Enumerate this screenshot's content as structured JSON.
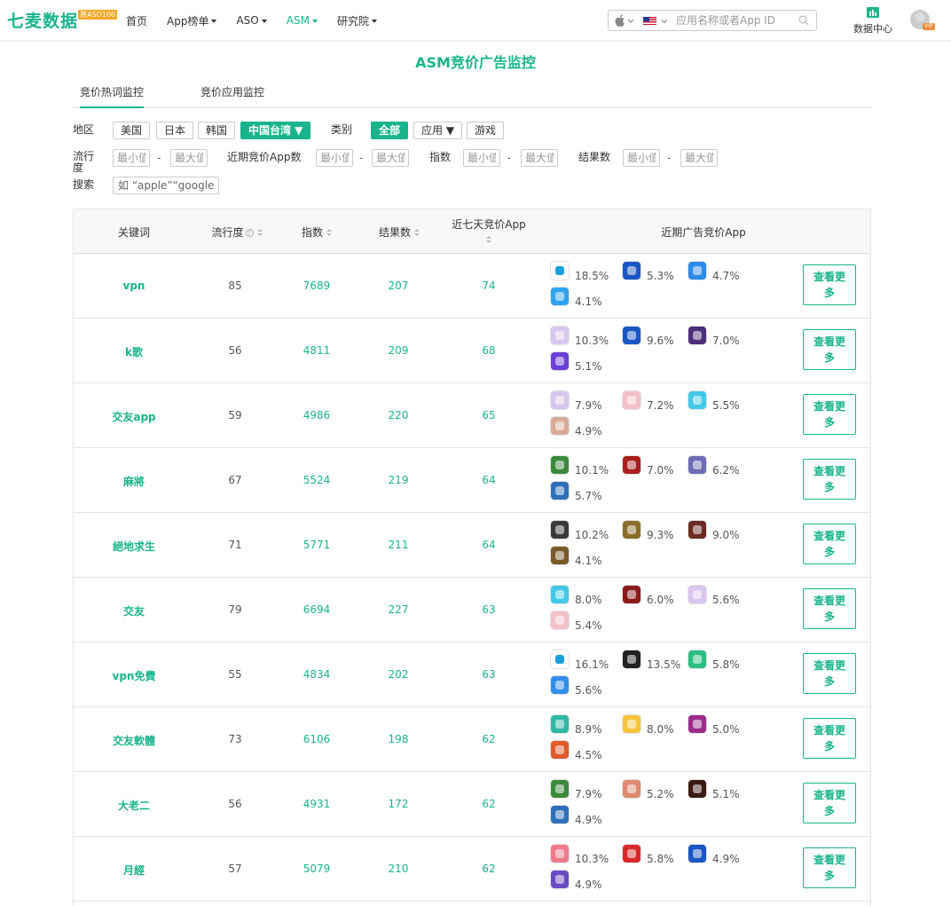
{
  "header": {
    "logo": "七麦数据",
    "logo_badge": "原ASO100",
    "nav": [
      {
        "label": "首页",
        "has_caret": false,
        "active": false
      },
      {
        "label": "App榜单",
        "has_caret": true,
        "active": false
      },
      {
        "label": "ASO",
        "has_caret": true,
        "active": false
      },
      {
        "label": "ASM",
        "has_caret": true,
        "active": true
      },
      {
        "label": "研究院",
        "has_caret": true,
        "active": false
      }
    ],
    "search_placeholder": "应用名称或者App ID",
    "data_center_label": "数据中心",
    "vip_badge": "VIP"
  },
  "page": {
    "title": "ASM竞价广告监控",
    "tabs": [
      "竞价热词监控",
      "竞价应用监控"
    ]
  },
  "filters": {
    "region_label": "地区",
    "regions": [
      {
        "label": "美国",
        "active": false
      },
      {
        "label": "日本",
        "active": false
      },
      {
        "label": "韩国",
        "active": false
      },
      {
        "label": "中国台湾 ▼",
        "active": true
      }
    ],
    "category_label": "类别",
    "categories": [
      {
        "label": "全部",
        "active": true
      },
      {
        "label": "应用 ▼",
        "active": false
      },
      {
        "label": "游戏",
        "active": false
      }
    ],
    "popularity_label": "流行度",
    "recent_apps_label": "近期竞价App数",
    "index_label": "指数",
    "results_label": "结果数",
    "min_placeholder": "最小值",
    "max_placeholder": "最大值",
    "range_dash": "-",
    "search_label": "搜索",
    "search_placeholder": "如 “apple”“google”等"
  },
  "table": {
    "headers": {
      "keyword": "关键词",
      "popularity": "流行度",
      "index": "指数",
      "results": "结果数",
      "seven_days": "近七天竞价App",
      "recent_apps": "近期广告竞价App"
    },
    "help_glyph": "?",
    "more_label": "查看更多",
    "rows": [
      {
        "keyword": "vpn",
        "popularity": "85",
        "index": "7689",
        "results": "207",
        "seven_days": "74",
        "apps": [
          {
            "icon": "wifi-vpn-icon",
            "pct": "18.5%",
            "color": "#ffffff"
          },
          {
            "icon": "m-shield-icon",
            "pct": "5.3%",
            "color": "#1a56c4"
          },
          {
            "icon": "camera-icon",
            "pct": "4.7%",
            "color": "#2d8ae8"
          },
          {
            "icon": "x-vpn-icon",
            "pct": "4.1%",
            "color": "#2fa4f0"
          }
        ]
      },
      {
        "keyword": "k歌",
        "popularity": "56",
        "index": "4811",
        "results": "209",
        "seven_days": "68",
        "apps": [
          {
            "icon": "anime-girl-icon",
            "pct": "10.3%",
            "color": "#d9c6ee"
          },
          {
            "icon": "m-shield-icon",
            "pct": "9.6%",
            "color": "#1a56c4"
          },
          {
            "icon": "music-stage-icon",
            "pct": "7.0%",
            "color": "#4a2e7a"
          },
          {
            "icon": "microphone-icon",
            "pct": "5.1%",
            "color": "#6a3fd8"
          }
        ]
      },
      {
        "keyword": "交友app",
        "popularity": "59",
        "index": "4986",
        "results": "220",
        "seven_days": "65",
        "apps": [
          {
            "icon": "anime-girl-icon",
            "pct": "7.9%",
            "color": "#d9c6ee"
          },
          {
            "icon": "anime-pink-icon",
            "pct": "7.2%",
            "color": "#f3c1c8"
          },
          {
            "icon": "chat-bubble-icon",
            "pct": "5.5%",
            "color": "#43c9e8"
          },
          {
            "icon": "woman-photo-icon",
            "pct": "4.9%",
            "color": "#d9a999"
          }
        ]
      },
      {
        "keyword": "麻將",
        "popularity": "67",
        "index": "5524",
        "results": "219",
        "seven_days": "64",
        "apps": [
          {
            "icon": "mahjong-man-icon",
            "pct": "10.1%",
            "color": "#3b8a3c"
          },
          {
            "icon": "dragon-icon",
            "pct": "7.0%",
            "color": "#a81e1e"
          },
          {
            "icon": "anime-warrior-icon",
            "pct": "6.2%",
            "color": "#6d6cb5"
          },
          {
            "icon": "mahjong-tiles-icon",
            "pct": "5.7%",
            "color": "#2f6fb9"
          }
        ]
      },
      {
        "keyword": "絕地求生",
        "popularity": "71",
        "index": "5771",
        "results": "211",
        "seven_days": "64",
        "apps": [
          {
            "icon": "soldier-icon",
            "pct": "10.2%",
            "color": "#3a3a3a"
          },
          {
            "icon": "battle-icon",
            "pct": "9.3%",
            "color": "#8a6d2a"
          },
          {
            "icon": "shooter-icon",
            "pct": "9.0%",
            "color": "#6b2b22"
          },
          {
            "icon": "survival-icon",
            "pct": "4.1%",
            "color": "#7a5a2a"
          }
        ]
      },
      {
        "keyword": "交友",
        "popularity": "79",
        "index": "6694",
        "results": "227",
        "seven_days": "63",
        "apps": [
          {
            "icon": "chat-bubble-icon",
            "pct": "8.0%",
            "color": "#43c9e8"
          },
          {
            "icon": "ring-icon",
            "pct": "6.0%",
            "color": "#8b1b1b"
          },
          {
            "icon": "anime-girl-icon",
            "pct": "5.6%",
            "color": "#d9c6ee"
          },
          {
            "icon": "anime-pink-icon",
            "pct": "5.4%",
            "color": "#f3c1c8"
          }
        ]
      },
      {
        "keyword": "vpn免費",
        "popularity": "55",
        "index": "4834",
        "results": "202",
        "seven_days": "63",
        "apps": [
          {
            "icon": "wifi-vpn-icon",
            "pct": "16.1%",
            "color": "#ffffff"
          },
          {
            "icon": "g-shield-icon",
            "pct": "13.5%",
            "color": "#222222"
          },
          {
            "icon": "green-arrow-icon",
            "pct": "5.8%",
            "color": "#2bbf82"
          },
          {
            "icon": "v-vpn-icon",
            "pct": "5.6%",
            "color": "#2f8fe8"
          }
        ]
      },
      {
        "keyword": "交友軟體",
        "popularity": "73",
        "index": "6106",
        "results": "198",
        "seven_days": "62",
        "apps": [
          {
            "icon": "house-heart-icon",
            "pct": "8.9%",
            "color": "#30b8a4"
          },
          {
            "icon": "dog-icon",
            "pct": "8.0%",
            "color": "#f7c43c"
          },
          {
            "icon": "hashtag-icon",
            "pct": "5.0%",
            "color": "#9b2d8a"
          },
          {
            "icon": "fox-icon",
            "pct": "4.5%",
            "color": "#e05a2a"
          }
        ]
      },
      {
        "keyword": "大老二",
        "popularity": "56",
        "index": "4931",
        "results": "172",
        "seven_days": "62",
        "apps": [
          {
            "icon": "mahjong-man-icon",
            "pct": "7.9%",
            "color": "#3b8a3c"
          },
          {
            "icon": "card-girl-icon",
            "pct": "5.2%",
            "color": "#e08a70"
          },
          {
            "icon": "calligraphy-icon",
            "pct": "5.1%",
            "color": "#3a1a12"
          },
          {
            "icon": "mahjong-tiles-icon",
            "pct": "4.9%",
            "color": "#2f6fb9"
          }
        ]
      },
      {
        "keyword": "月經",
        "popularity": "57",
        "index": "5079",
        "results": "210",
        "seven_days": "62",
        "apps": [
          {
            "icon": "period-drop-icon",
            "pct": "10.3%",
            "color": "#f2798c"
          },
          {
            "icon": "slot-machine-icon",
            "pct": "5.8%",
            "color": "#d9282a"
          },
          {
            "icon": "m-shield-icon",
            "pct": "4.9%",
            "color": "#1a56c4"
          },
          {
            "icon": "slots-girl-icon",
            "pct": "4.9%",
            "color": "#6b4ac2"
          }
        ]
      }
    ]
  }
}
